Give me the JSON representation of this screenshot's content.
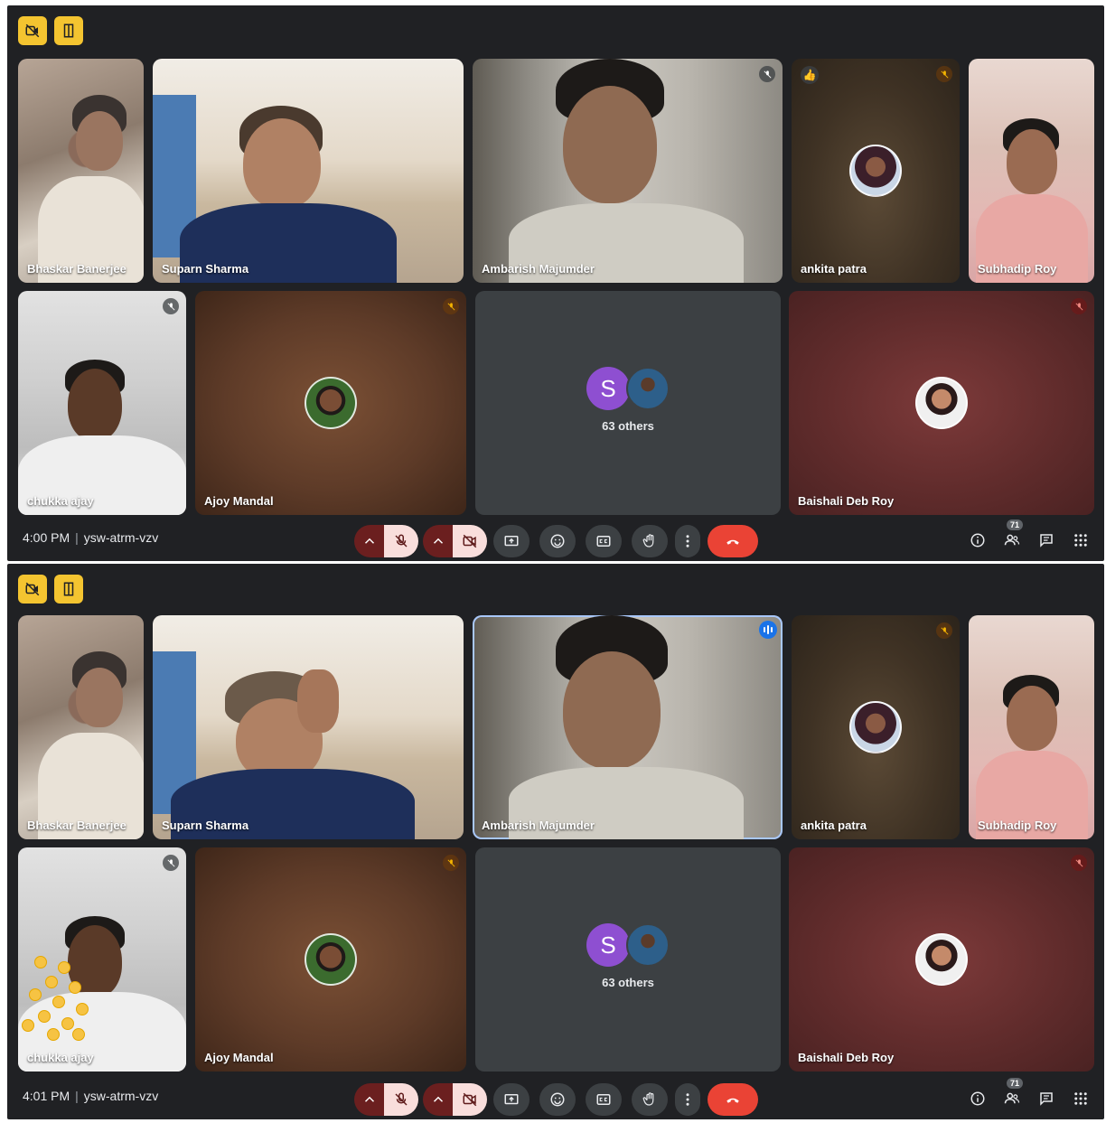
{
  "frames": [
    {
      "participants": {
        "bhaskar": "Bhaskar Banerjee",
        "suparn": "Suparn Sharma",
        "ambarish": "Ambarish Majumder",
        "ankita": "ankita patra",
        "subhadip": "Subhadip Roy",
        "chukka": "chukka ajay",
        "ajoy": "Ajoy Mandal",
        "baishali": "Baishali Deb Roy"
      },
      "others": {
        "initial": "S",
        "label": "63 others"
      },
      "footer": {
        "time": "4:00 PM",
        "meeting_code": "ysw-atrm-vzv",
        "people_count": "71"
      }
    },
    {
      "participants": {
        "bhaskar": "Bhaskar Banerjee",
        "suparn": "Suparn Sharma",
        "ambarish": "Ambarish Majumder",
        "ankita": "ankita patra",
        "subhadip": "Subhadip Roy",
        "chukka": "chukka ajay",
        "ajoy": "Ajoy Mandal",
        "baishali": "Baishali Deb Roy"
      },
      "others": {
        "initial": "S",
        "label": "63 others"
      },
      "footer": {
        "time": "4:01 PM",
        "meeting_code": "ysw-atrm-vzv",
        "people_count": "71"
      }
    }
  ],
  "icons": {
    "top_badges": [
      "no-video-icon",
      "door-icon"
    ],
    "controls": [
      "chevron-up-icon",
      "mic-off-icon",
      "chevron-up-icon",
      "camera-off-icon",
      "present-screen-icon",
      "emoji-icon",
      "captions-icon",
      "raise-hand-icon",
      "more-vert-icon",
      "end-call-icon"
    ],
    "right": [
      "info-icon",
      "people-icon",
      "chat-icon",
      "activities-icon"
    ]
  },
  "colors": {
    "background": "#202124",
    "end_call": "#ea4335",
    "muted_button": "#f9dedc",
    "badge": "#f4c430",
    "others_avatar": "#8e4fd1"
  }
}
